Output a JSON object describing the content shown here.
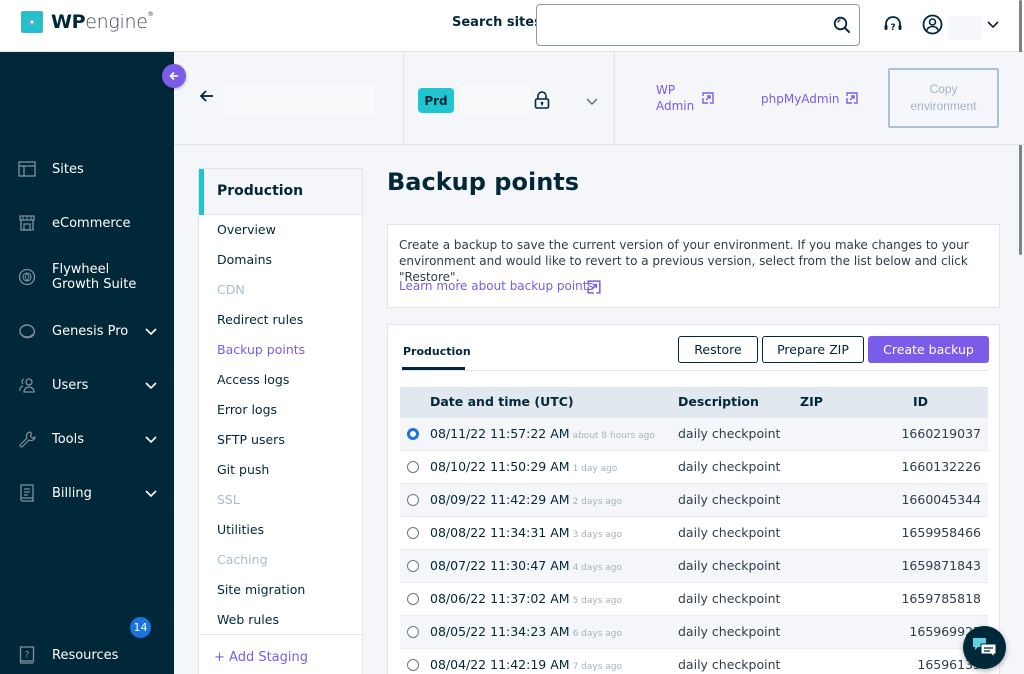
{
  "topbar": {
    "logo": {
      "brand_bold": "WP",
      "brand_light": "engine",
      "trademark": "®"
    },
    "search_label": "Search sites",
    "search_placeholder": "",
    "search_value": "",
    "icons": {
      "search": "search-icon",
      "help": "help-headset-icon",
      "user": "user-circle-icon",
      "menu": "chevron-down-icon"
    }
  },
  "sidebar": {
    "collapse_icon": "arrow-left-icon",
    "items": [
      {
        "label": "Sites",
        "icon": "sites-icon",
        "expandable": false
      },
      {
        "label": "eCommerce",
        "icon": "store-icon",
        "expandable": false
      },
      {
        "label": "Flywheel Growth Suite",
        "label_line1": "Flywheel",
        "label_line2": "Growth Suite",
        "icon": "flywheel-icon",
        "expandable": false
      },
      {
        "label": "Genesis Pro",
        "icon": "genesis-icon",
        "expandable": true
      },
      {
        "label": "Users",
        "icon": "users-icon",
        "expandable": true
      },
      {
        "label": "Tools",
        "icon": "wrench-icon",
        "expandable": true
      },
      {
        "label": "Billing",
        "icon": "receipt-icon",
        "expandable": true
      },
      {
        "label": "Resources",
        "icon": "book-help-icon",
        "expandable": false
      }
    ],
    "resources_badge": "14"
  },
  "env_header": {
    "env_badge": "Prd",
    "wp_admin_line1": "WP",
    "wp_admin_line2": "Admin",
    "phpmyadmin": "phpMyAdmin",
    "copy_env_line1": "Copy",
    "copy_env_line2": "environment"
  },
  "subnav": {
    "heading": "Production",
    "items": [
      {
        "label": "Overview",
        "state": "normal"
      },
      {
        "label": "Domains",
        "state": "normal"
      },
      {
        "label": "CDN",
        "state": "disabled"
      },
      {
        "label": "Redirect rules",
        "state": "normal"
      },
      {
        "label": "Backup points",
        "state": "active"
      },
      {
        "label": "Access logs",
        "state": "normal"
      },
      {
        "label": "Error logs",
        "state": "normal"
      },
      {
        "label": "SFTP users",
        "state": "normal"
      },
      {
        "label": "Git push",
        "state": "normal"
      },
      {
        "label": "SSL",
        "state": "disabled"
      },
      {
        "label": "Utilities",
        "state": "normal"
      },
      {
        "label": "Caching",
        "state": "disabled"
      },
      {
        "label": "Site migration",
        "state": "normal"
      },
      {
        "label": "Web rules",
        "state": "normal"
      }
    ],
    "add_staging": "+ Add Staging"
  },
  "main": {
    "title": "Backup points",
    "info_text": "Create a backup to save the current version of your environment. If you make changes to your environment and would like to revert to a previous version, select from the list below and click \"Restore\".",
    "learn_more": "Learn more about backup points",
    "tab_label": "Production",
    "buttons": {
      "restore": "Restore",
      "prepare_zip": "Prepare ZIP",
      "create_backup": "Create backup"
    },
    "table": {
      "columns": [
        "Date and time (UTC)",
        "Description",
        "ZIP",
        "ID"
      ],
      "rows": [
        {
          "selected": true,
          "datetime": "08/11/22 11:57:22 AM",
          "ago": "about 8 hours ago",
          "description": "daily checkpoint",
          "zip": "",
          "id": "1660219037"
        },
        {
          "selected": false,
          "datetime": "08/10/22 11:50:29 AM",
          "ago": "1 day ago",
          "description": "daily checkpoint",
          "zip": "",
          "id": "1660132226"
        },
        {
          "selected": false,
          "datetime": "08/09/22 11:42:29 AM",
          "ago": "2 days ago",
          "description": "daily checkpoint",
          "zip": "",
          "id": "1660045344"
        },
        {
          "selected": false,
          "datetime": "08/08/22 11:34:31 AM",
          "ago": "3 days ago",
          "description": "daily checkpoint",
          "zip": "",
          "id": "1659958466"
        },
        {
          "selected": false,
          "datetime": "08/07/22 11:30:47 AM",
          "ago": "4 days ago",
          "description": "daily checkpoint",
          "zip": "",
          "id": "1659871843"
        },
        {
          "selected": false,
          "datetime": "08/06/22 11:37:02 AM",
          "ago": "5 days ago",
          "description": "daily checkpoint",
          "zip": "",
          "id": "1659785818"
        },
        {
          "selected": false,
          "datetime": "08/05/22 11:34:23 AM",
          "ago": "6 days ago",
          "description": "daily checkpoint",
          "zip": "",
          "id": "165969925"
        },
        {
          "selected": false,
          "datetime": "08/04/22 11:42:19 AM",
          "ago": "7 days ago",
          "description": "daily checkpoint",
          "zip": "",
          "id": "16596133"
        }
      ]
    }
  },
  "chat": {
    "icon": "chat-bubbles-icon"
  },
  "colors": {
    "sidebar_bg": "#002838",
    "accent_purple": "#7b5ce9",
    "accent_teal": "#1fc6d0",
    "badge_blue": "#1a74e0"
  }
}
